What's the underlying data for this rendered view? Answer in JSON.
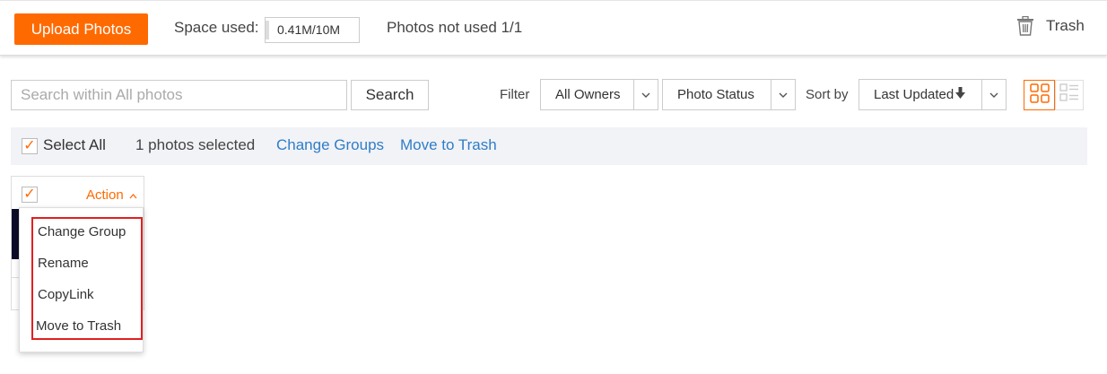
{
  "header": {
    "upload_label": "Upload Photos",
    "space_label": "Space used:",
    "space_value": "0.41M/10M",
    "photos_not_used": "Photos not used 1/1",
    "trash_label": "Trash",
    "trash_icon": "trash-icon",
    "accent_color": "#ff6a00"
  },
  "toolbar": {
    "search_placeholder": "Search within All photos",
    "search_button": "Search",
    "filter_label": "Filter",
    "owners_value": "All Owners",
    "status_value": "Photo Status",
    "sort_label": "Sort by",
    "sort_value": "Last Updated",
    "sort_icon": "arrow-down-icon",
    "view_grid_icon": "grid-view-icon",
    "view_list_icon": "list-view-icon"
  },
  "selection": {
    "select_all_label": "Select All",
    "selected_count": "1 photos selected",
    "change_groups": "Change Groups",
    "move_to_trash": "Move to Trash",
    "link_color": "#2f7dc7"
  },
  "card": {
    "action_label": "Action",
    "checked": true
  },
  "action_menu": {
    "items": [
      "Change Group",
      "Rename",
      "CopyLink",
      "Move to Trash"
    ],
    "highlight_color": "#e02020"
  }
}
